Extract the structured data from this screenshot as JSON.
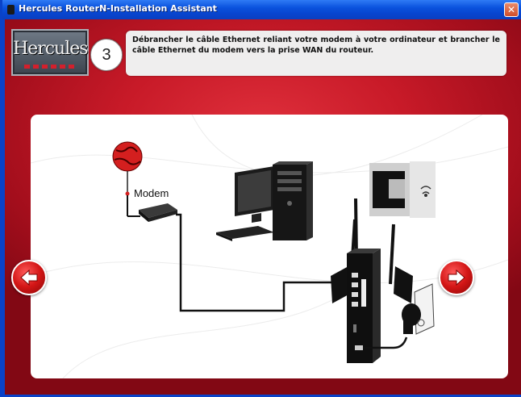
{
  "window": {
    "title": "Hercules RouterN-Installation Assistant",
    "close_glyph": "✕"
  },
  "header": {
    "logo_text": "Hercules",
    "step_number": "3",
    "instruction": "Débrancher le câble Ethernet reliant votre modem à votre ordinateur et brancher le câble Ethernet du modem vers la prise WAN du routeur."
  },
  "diagram": {
    "modem_label": "Modem",
    "icons": [
      "globe-icon",
      "modem-icon",
      "computer-icon",
      "ethernet-jack-icon",
      "router-icon",
      "power-plug-icon"
    ]
  },
  "navigation": {
    "back_icon": "arrow-left-icon",
    "next_icon": "arrow-right-icon"
  },
  "colors": {
    "background_red": "#c81a28",
    "titlebar_blue": "#0a52dd",
    "panel": "#ffffff"
  }
}
